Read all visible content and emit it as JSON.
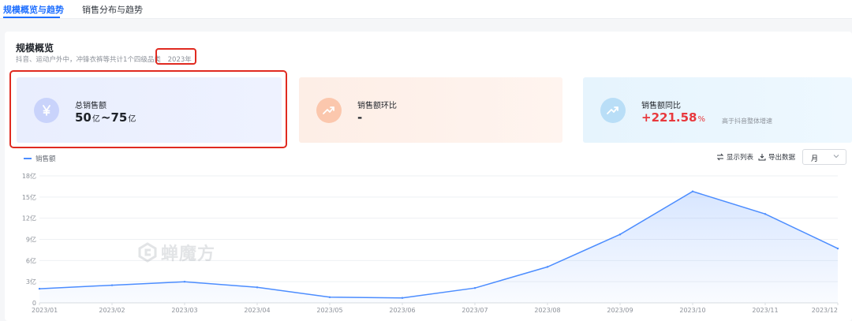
{
  "tabs": [
    {
      "label": "规模概览与趋势",
      "active": true
    },
    {
      "label": "销售分布与趋势",
      "active": false
    }
  ],
  "overview": {
    "title": "规模概览",
    "description": "抖音、运动户外中，冲锋衣裤等共计1个四级品类",
    "year": "2023年"
  },
  "metrics": {
    "total_sales": {
      "label": "总销售额",
      "low": "50",
      "sep": "~",
      "high": "75",
      "unit": "亿",
      "icon": "yuan-icon"
    },
    "mom": {
      "label": "销售额环比",
      "value": "-",
      "icon": "trend-up-icon"
    },
    "yoy": {
      "label": "销售额同比",
      "value": "+221.58",
      "suffix": "%",
      "note": "高于抖音整体增速",
      "icon": "trend-up-icon"
    }
  },
  "toolbar": {
    "show_list": "显示列表",
    "export": "导出数据",
    "period": "月"
  },
  "watermark": {
    "brand": "蝉魔方"
  },
  "colors": {
    "line": "#4c8dff",
    "highlight": "#e02a20",
    "up": "#e8383d"
  },
  "chart_data": {
    "type": "area",
    "legend": [
      "销售额"
    ],
    "categories": [
      "2023/01",
      "2023/02",
      "2023/03",
      "2023/04",
      "2023/05",
      "2023/06",
      "2023/07",
      "2023/08",
      "2023/09",
      "2023/10",
      "2023/11",
      "2023/12"
    ],
    "series": [
      {
        "name": "销售额",
        "values": [
          2.0,
          2.5,
          3.0,
          2.2,
          0.8,
          0.7,
          2.1,
          5.1,
          9.7,
          15.8,
          12.6,
          7.7
        ]
      }
    ],
    "y_ticks": [
      "0",
      "3亿",
      "6亿",
      "9亿",
      "12亿",
      "15亿",
      "18亿"
    ],
    "ylim": [
      0,
      18
    ],
    "grid": true
  }
}
